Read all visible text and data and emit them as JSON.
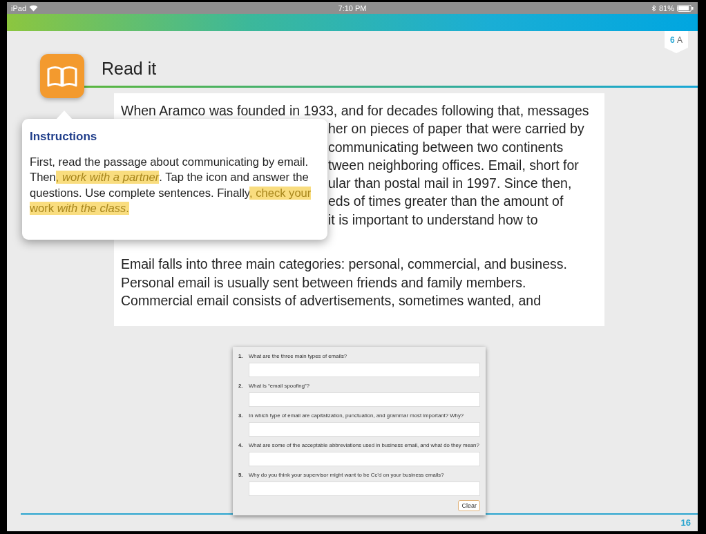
{
  "status_bar": {
    "device": "iPad",
    "time": "7:10 PM",
    "battery": "81%"
  },
  "page_tag": {
    "number": "6",
    "letter": "A"
  },
  "title": "Read it",
  "passage": {
    "paragraphs": [
      {
        "lines": [
          {
            "text": "When Aramco was founded in 1933, and for decades following that, messages",
            "covered": false
          },
          {
            "text": "her on pieces of paper that were carried by",
            "covered": true
          },
          {
            "text": "communicating between two continents",
            "covered": true
          },
          {
            "text": "tween neighboring offices. Email, short for",
            "covered": true
          },
          {
            "text": "ular than postal mail in 1997. Since then,",
            "covered": true
          },
          {
            "text": "eds of times greater than the amount of",
            "covered": true
          },
          {
            "text": "it is important to understand how to",
            "covered": true
          }
        ]
      },
      {
        "lines": [
          {
            "text": "Email falls into three main categories: personal, commercial, and business.",
            "covered": false
          },
          {
            "text": "Personal email is usually sent between friends and family members.",
            "covered": false
          },
          {
            "text": "Commercial email consists of advertisements, sometimes wanted, and",
            "covered": false
          }
        ]
      }
    ]
  },
  "instructions": {
    "heading": "Instructions",
    "segments": [
      {
        "text": "First, read the passage about communicating by email. Then",
        "highlighted": false
      },
      {
        "text": ", *work with a partner*",
        "highlighted": true
      },
      {
        "text": ". Tap the icon and answer the questions. Use complete sentences. Finally",
        "highlighted": false
      },
      {
        "text": ", check your work *with the class*.",
        "highlighted": true
      }
    ]
  },
  "questions": [
    {
      "number": "1.",
      "text": "What are the three main types of emails?"
    },
    {
      "number": "2.",
      "text": "What is “email spoofing”?"
    },
    {
      "number": "3.",
      "text": "In which type of email are capitalization, punctuation, and grammar most important? Why?"
    },
    {
      "number": "4.",
      "text": "What are some of the acceptable abbreviations used in business email, and what do they mean?"
    },
    {
      "number": "5.",
      "text": "Why do you think your supervisor might want to be Cc’d on your business emails?"
    }
  ],
  "clear_button": "Clear",
  "page_number": "16"
}
